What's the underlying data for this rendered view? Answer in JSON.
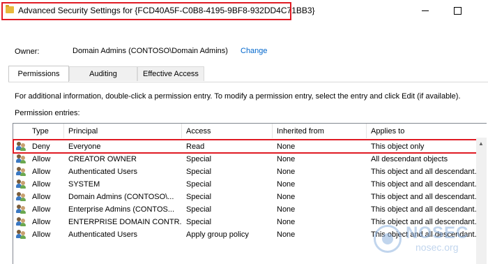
{
  "window": {
    "title": "Advanced Security Settings for {FCD40A5F-C0B8-4195-9BF8-932DD4C71BB3}",
    "minimize_glyph": "—",
    "maximize_glyph": "☐"
  },
  "owner": {
    "label": "Owner:",
    "value": "Domain Admins (CONTOSO\\Domain Admins)",
    "change_link": "Change"
  },
  "tabs": [
    {
      "label": "Permissions",
      "active": true
    },
    {
      "label": "Auditing",
      "active": false
    },
    {
      "label": "Effective Access",
      "active": false
    }
  ],
  "info_text": "For additional information, double-click a permission entry. To modify a permission entry, select the entry and click Edit (if available).",
  "entries_label": "Permission entries:",
  "table": {
    "columns": [
      "Type",
      "Principal",
      "Access",
      "Inherited from",
      "Applies to"
    ],
    "rows": [
      {
        "type": "Deny",
        "principal": "Everyone",
        "access": "Read",
        "inherited": "None",
        "applies": "This object only",
        "highlighted": true
      },
      {
        "type": "Allow",
        "principal": "CREATOR OWNER",
        "access": "Special",
        "inherited": "None",
        "applies": "All descendant objects"
      },
      {
        "type": "Allow",
        "principal": "Authenticated Users",
        "access": "Special",
        "inherited": "None",
        "applies": "This object and all descendant..."
      },
      {
        "type": "Allow",
        "principal": "SYSTEM",
        "access": "Special",
        "inherited": "None",
        "applies": "This object and all descendant..."
      },
      {
        "type": "Allow",
        "principal": "Domain Admins (CONTOSO\\...",
        "access": "Special",
        "inherited": "None",
        "applies": "This object and all descendant..."
      },
      {
        "type": "Allow",
        "principal": "Enterprise Admins (CONTOS...",
        "access": "Special",
        "inherited": "None",
        "applies": "This object and all descendant..."
      },
      {
        "type": "Allow",
        "principal": "ENTERPRISE DOMAIN CONTR...",
        "access": "Special",
        "inherited": "None",
        "applies": "This object and all descendant..."
      },
      {
        "type": "Allow",
        "principal": "Authenticated Users",
        "access": "Apply group policy",
        "inherited": "None",
        "applies": "This object and all descendant..."
      }
    ]
  },
  "watermark": {
    "brand": "NOSEC",
    "sub": "nosec.org"
  },
  "colors": {
    "highlight": "#e01b24",
    "link": "#0066cc"
  }
}
